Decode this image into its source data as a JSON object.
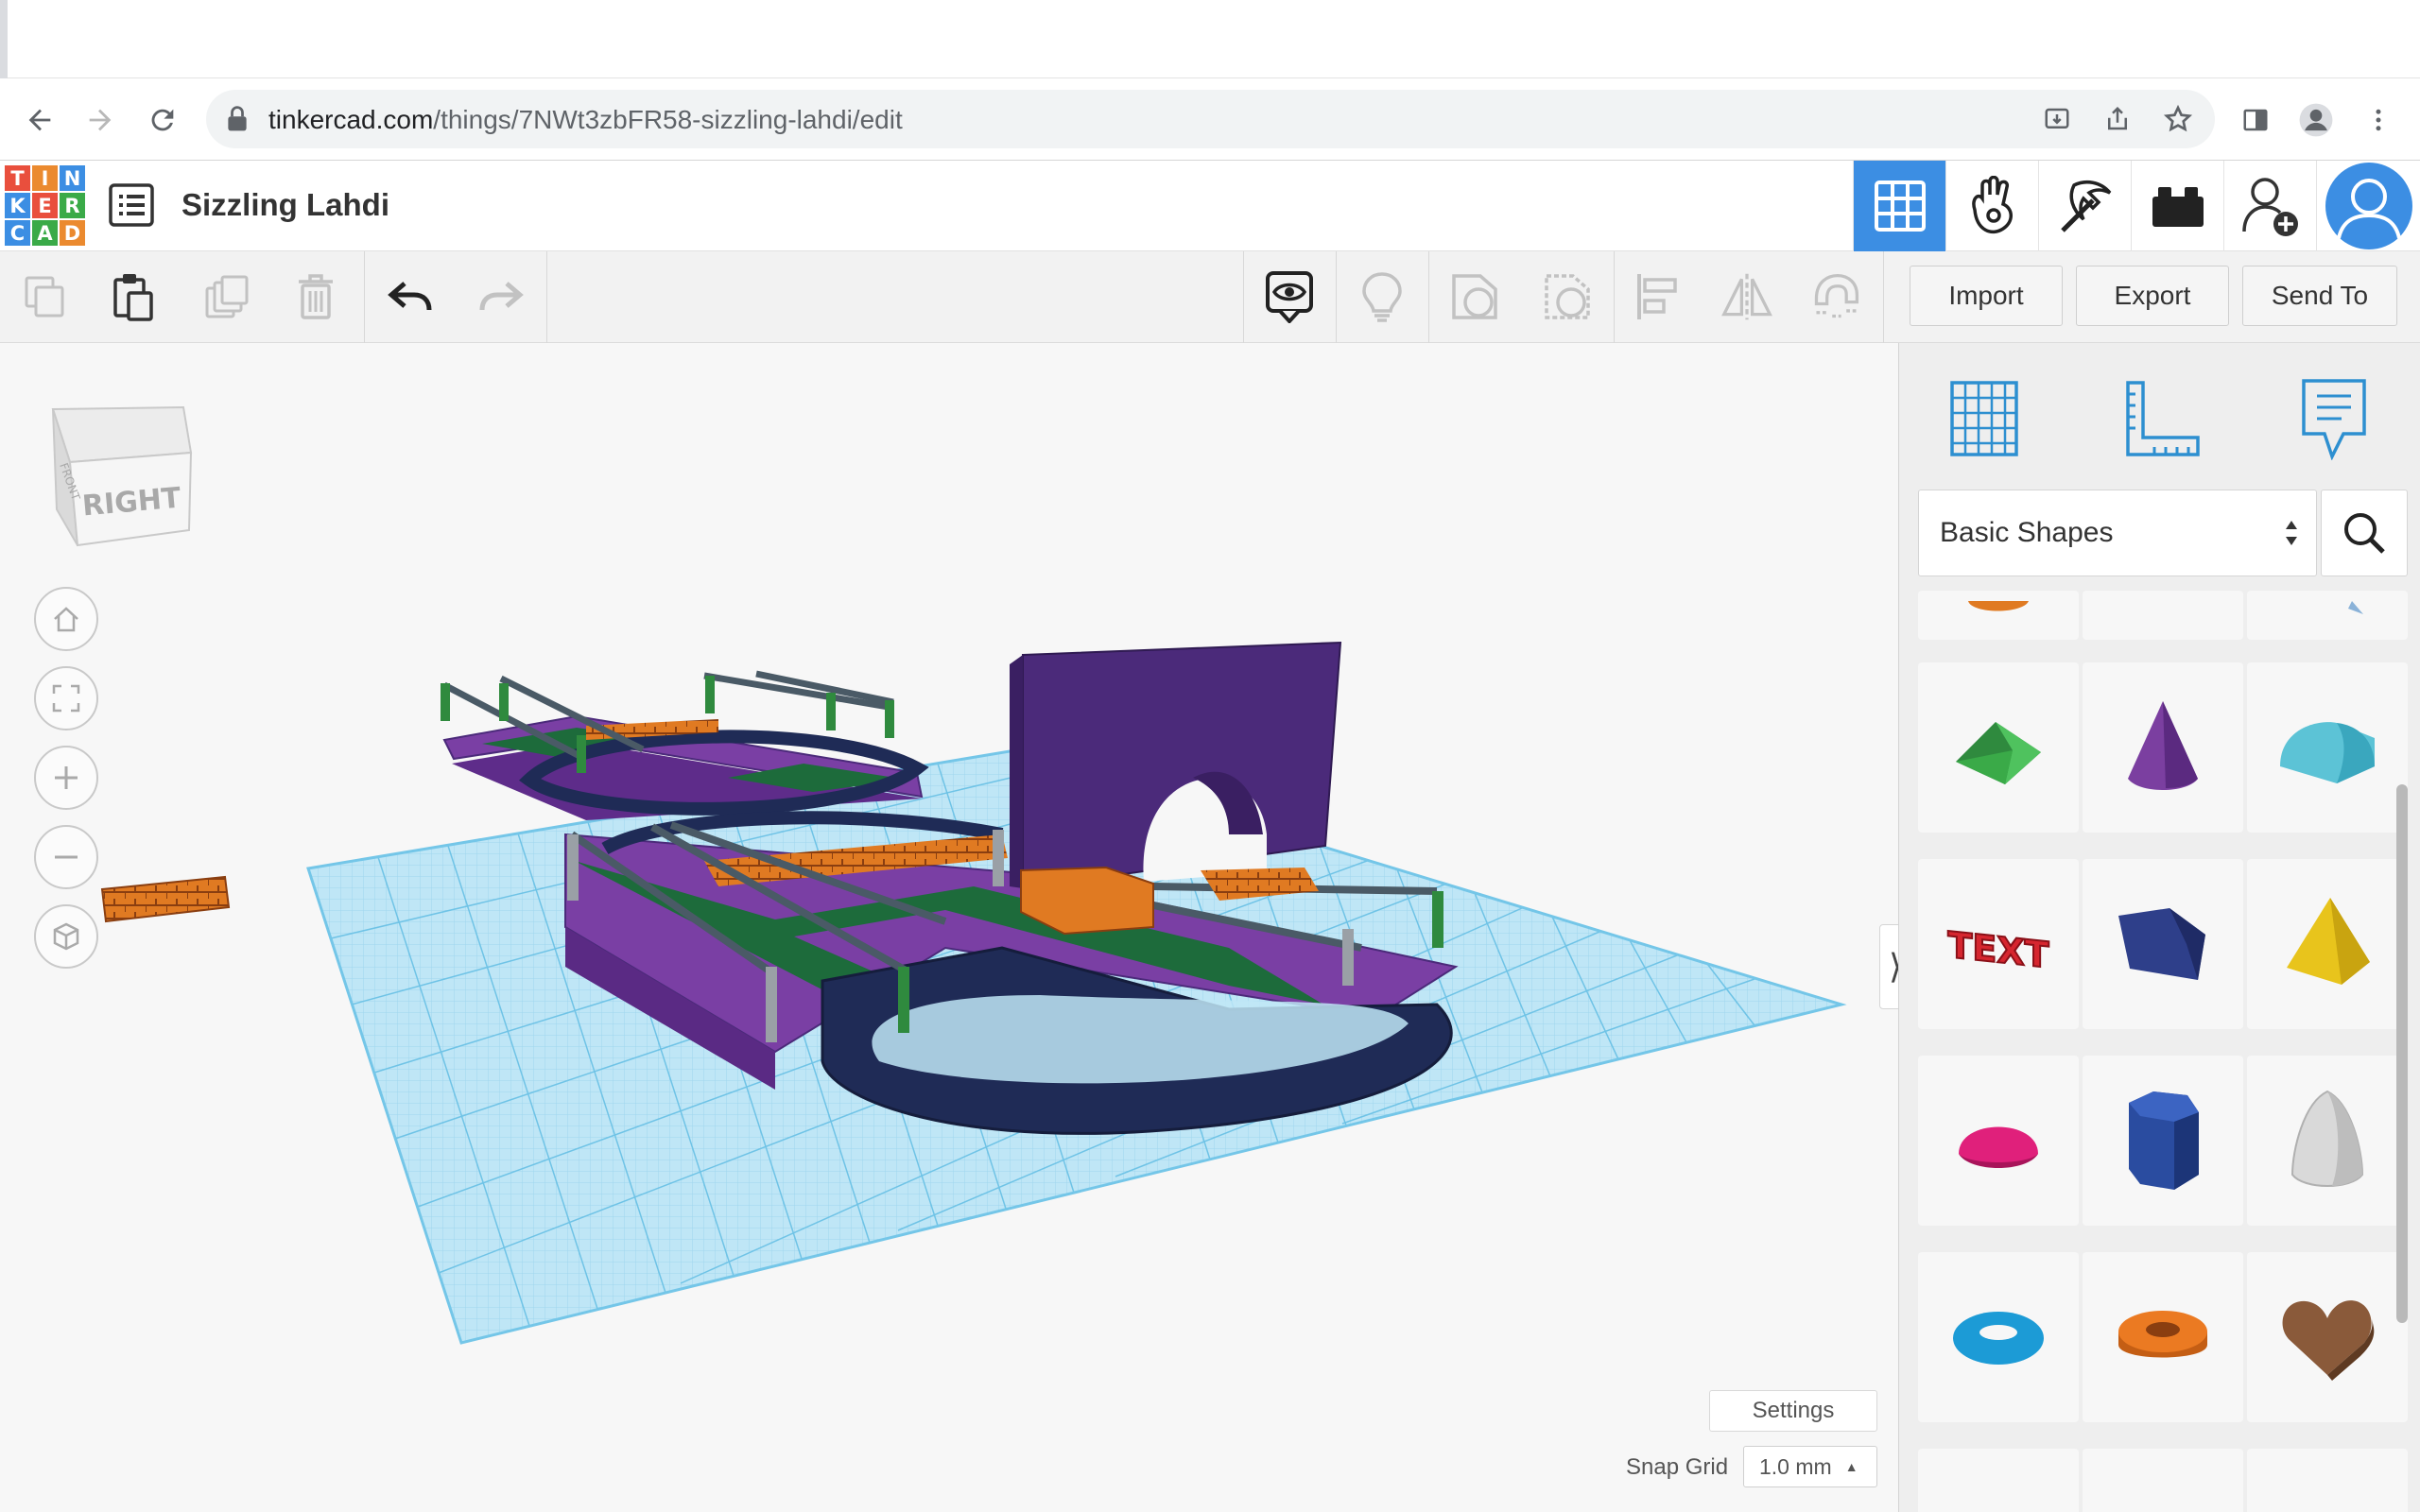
{
  "browser": {
    "url_domain": "tinkercad.com",
    "url_path": "/things/7NWt3zbFR58-sizzling-lahdi/edit"
  },
  "header": {
    "logo_letters": [
      "T",
      "I",
      "N",
      "K",
      "E",
      "R",
      "C",
      "A",
      "D"
    ],
    "logo_colors": [
      "#e94f3d",
      "#eb8a2f",
      "#3c8ee3",
      "#3c8ee3",
      "#e94f3d",
      "#3aaa48",
      "#3c8ee3",
      "#3aaa48",
      "#eb8a2f"
    ],
    "design_title": "Sizzling Lahdi",
    "modes": [
      "3d-design-icon",
      "circuits-icon",
      "codeblocks-icon",
      "bricks-icon",
      "invite-user-icon",
      "profile-avatar"
    ]
  },
  "toolbar": {
    "tools": [
      "copy-icon",
      "paste-icon",
      "duplicate-icon",
      "delete-icon",
      "undo-icon",
      "redo-icon"
    ],
    "view_tools": [
      "show-hidden-icon",
      "notes-icon",
      "solid-shape-icon",
      "hole-shape-icon",
      "align-icon",
      "mirror-icon",
      "group-magnet-icon"
    ],
    "import_label": "Import",
    "export_label": "Export",
    "send_to_label": "Send To"
  },
  "viewport": {
    "view_cube_label": "RIGHT",
    "view_cube_side_label": "FRONT",
    "controls": [
      "home-view-icon",
      "fit-view-icon",
      "zoom-in-icon",
      "zoom-out-icon",
      "perspective-icon"
    ],
    "settings_label": "Settings",
    "snap_grid_label": "Snap Grid",
    "snap_grid_value": "1.0 mm"
  },
  "panel": {
    "tabs": [
      "workplane-icon",
      "ruler-icon",
      "notes-icon"
    ],
    "library_label": "Basic Shapes",
    "shapes": [
      {
        "name": "roof",
        "color": "#3aaa48"
      },
      {
        "name": "cone",
        "color": "#7b3fa0"
      },
      {
        "name": "round-roof",
        "color": "#5cc3d6"
      },
      {
        "name": "text",
        "color": "#d6262f"
      },
      {
        "name": "polygon",
        "color": "#2e3f8a"
      },
      {
        "name": "pyramid",
        "color": "#e8c41c"
      },
      {
        "name": "half-sphere",
        "color": "#e0207b"
      },
      {
        "name": "hexagonal-prism",
        "color": "#2a4ca0"
      },
      {
        "name": "paraboloid",
        "color": "#d9d9d9"
      },
      {
        "name": "torus",
        "color": "#1c9bd6"
      },
      {
        "name": "tube",
        "color": "#eb7a22"
      },
      {
        "name": "heart",
        "color": "#8a5a3a"
      }
    ],
    "shape_text_label": "TEXT"
  },
  "colors": {
    "accent": "#3c8ee3",
    "workplane_grid": "#8fd0ea",
    "deck_purple": "#7a3fa4",
    "deck_green": "#1d6b3b",
    "track_navy": "#1f2b56",
    "brick_orange": "#e07a22",
    "arch_purple": "#4b2a7a"
  }
}
